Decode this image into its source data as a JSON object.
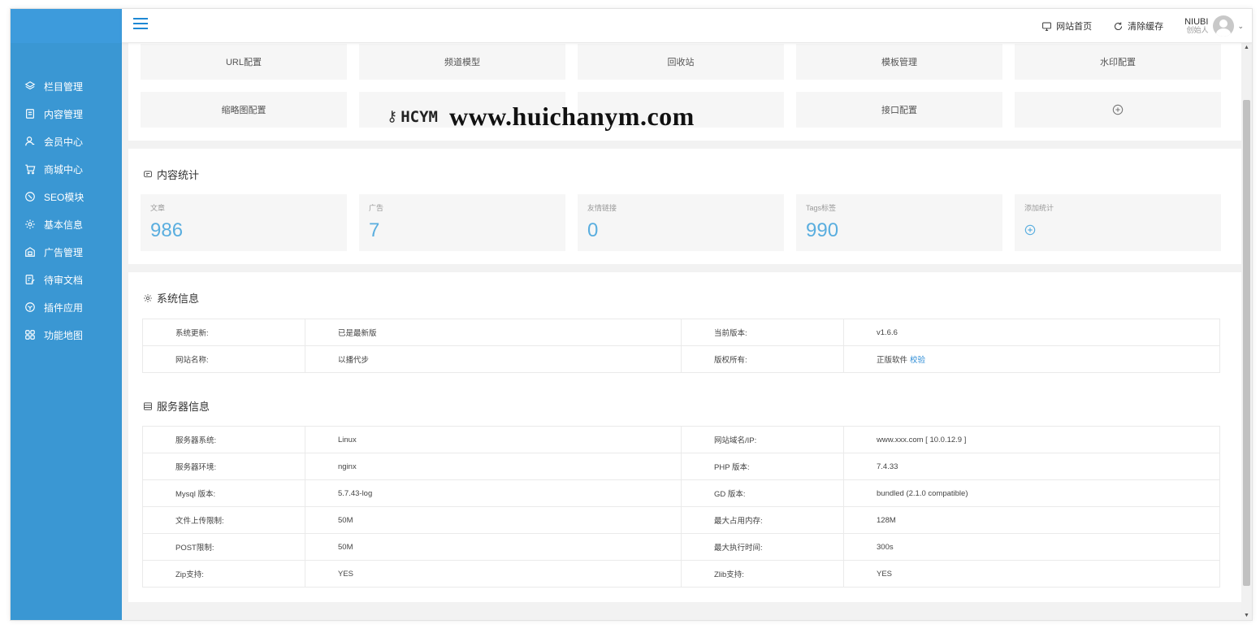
{
  "header": {
    "home_link": "网站首页",
    "clear_cache": "清除缓存",
    "user_name": "NIUBI",
    "user_role": "创始人"
  },
  "sidebar": {
    "items": [
      {
        "label": "栏目管理",
        "icon": "layers-icon"
      },
      {
        "label": "内容管理",
        "icon": "document-icon"
      },
      {
        "label": "会员中心",
        "icon": "user-icon"
      },
      {
        "label": "商城中心",
        "icon": "cart-icon"
      },
      {
        "label": "SEO模块",
        "icon": "seo-icon"
      },
      {
        "label": "基本信息",
        "icon": "gear-icon"
      },
      {
        "label": "广告管理",
        "icon": "ad-icon"
      },
      {
        "label": "待审文档",
        "icon": "edit-document-icon"
      },
      {
        "label": "插件应用",
        "icon": "box-icon"
      },
      {
        "label": "功能地图",
        "icon": "grid-icon"
      }
    ]
  },
  "quick": {
    "row1": [
      "URL配置",
      "频道模型",
      "回收站",
      "模板管理",
      "水印配置"
    ],
    "row2": [
      "缩略图配置",
      "",
      "",
      "接口配置"
    ]
  },
  "watermark": {
    "logo": "HCYM",
    "url": "www.huichanym.com"
  },
  "stats": {
    "title": "内容统计",
    "items": [
      {
        "label": "文章",
        "value": "986"
      },
      {
        "label": "广告",
        "value": "7"
      },
      {
        "label": "友情链接",
        "value": "0"
      },
      {
        "label": "Tags标签",
        "value": "990"
      }
    ],
    "add_label": "添加统计"
  },
  "system": {
    "title": "系统信息",
    "rows": [
      {
        "k1": "系统更新:",
        "v1": "已是最新版",
        "k2": "当前版本:",
        "v2": "v1.6.6"
      },
      {
        "k1": "网站名称:",
        "v1": "以播代步",
        "k2": "版权所有:",
        "v2": "正版软件"
      }
    ],
    "verify_label": "校验"
  },
  "server": {
    "title": "服务器信息",
    "rows": [
      {
        "k1": "服务器系统:",
        "v1": "Linux",
        "k2": "网站域名/IP:",
        "v2": "www.xxx.com [ 10.0.12.9 ]"
      },
      {
        "k1": "服务器环境:",
        "v1": "nginx",
        "k2": "PHP 版本:",
        "v2": "7.4.33"
      },
      {
        "k1": "Mysql 版本:",
        "v1": "5.7.43-log",
        "k2": "GD 版本:",
        "v2": "bundled (2.1.0 compatible)"
      },
      {
        "k1": "文件上传限制:",
        "v1": "50M",
        "k2": "最大占用内存:",
        "v2": "128M"
      },
      {
        "k1": "POST限制:",
        "v1": "50M",
        "k2": "最大执行时间:",
        "v2": "300s"
      },
      {
        "k1": "Zip支持:",
        "v1": "YES",
        "k2": "Zlib支持:",
        "v2": "YES"
      }
    ]
  },
  "colors": {
    "sidebar": "#3a97d3",
    "accent": "#1e88d4",
    "stat_value": "#5aaedf"
  }
}
